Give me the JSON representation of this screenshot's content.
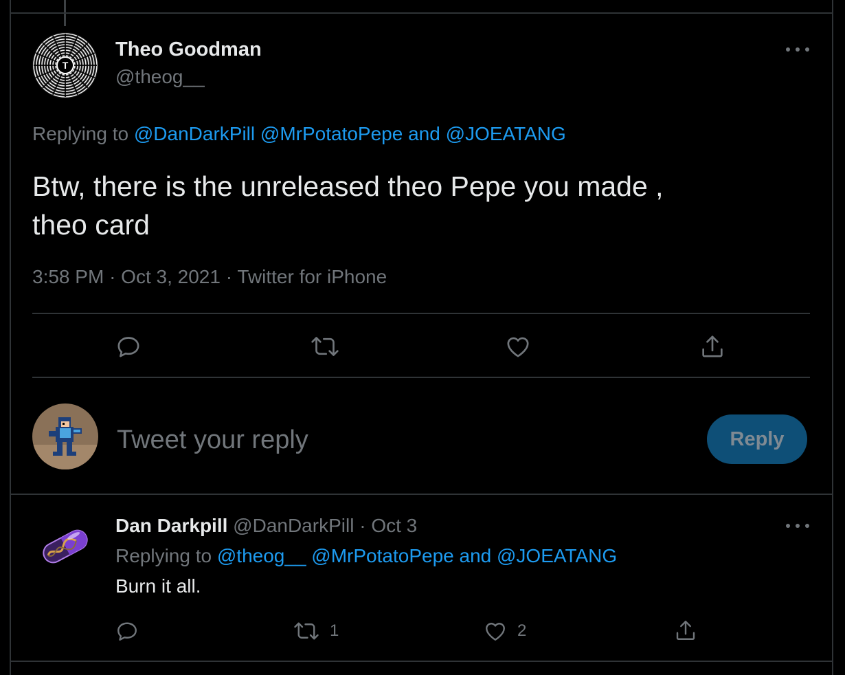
{
  "main_tweet": {
    "author_name": "Theo Goodman",
    "author_handle": "@theog__",
    "avatar_letter": "T",
    "replying_prefix": "Replying to",
    "replying_to": [
      "@DanDarkPill",
      "@MrPotatoPepe"
    ],
    "replying_and": "and",
    "replying_last": "@JOEATANG",
    "text_line1": "Btw, there is the unreleased theo Pepe you made ,",
    "text_line2": "theo card",
    "time": "3:58 PM",
    "date": "Oct 3, 2021",
    "source": "Twitter for iPhone",
    "sep": "·"
  },
  "compose": {
    "placeholder": "Tweet your reply",
    "reply_button": "Reply"
  },
  "reply_tweet": {
    "author_name": "Dan Darkpill",
    "author_handle": "@DanDarkPill",
    "sep": "·",
    "date": "Oct 3",
    "replying_prefix": "Replying to",
    "replying_to": [
      "@theog__",
      "@MrPotatoPepe"
    ],
    "replying_and": "and",
    "replying_last": "@JOEATANG",
    "text": "Burn it all.",
    "retweet_count": "1",
    "like_count": "2"
  },
  "icons": {
    "reply": "reply-icon",
    "retweet": "retweet-icon",
    "like": "heart-icon",
    "share": "share-icon",
    "more": "more-icon"
  },
  "colors": {
    "background": "#000000",
    "text": "#e7e9ea",
    "muted": "#71767b",
    "link": "#1d9bf0",
    "reply_button_bg": "#0e4f77",
    "reply_button_text": "#7f8a93"
  }
}
